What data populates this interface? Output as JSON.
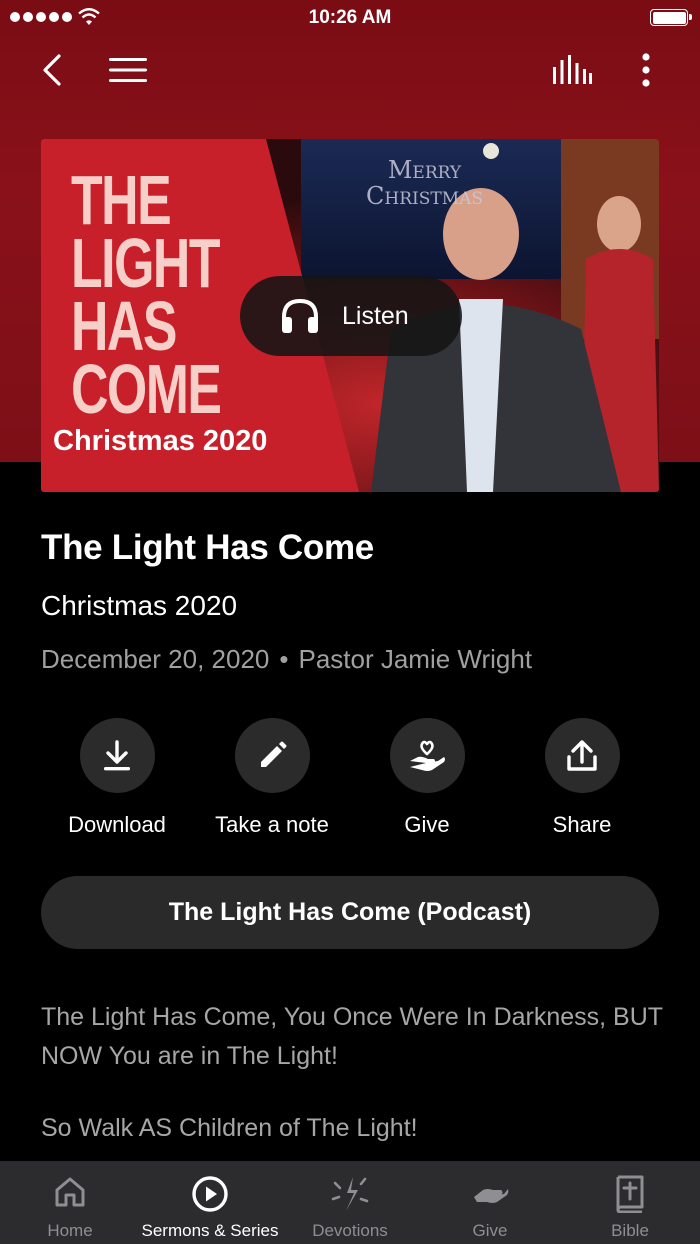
{
  "status_bar": {
    "time": "10:26 AM"
  },
  "nav": {
    "back_icon": "chevron-left-icon",
    "menu_icon": "hamburger-menu-icon",
    "audio_icon": "audio-bars-icon",
    "more_icon": "more-vertical-icon"
  },
  "hero": {
    "artwork_title": "THE\nLIGHT\nHAS\nCOME",
    "artwork_subtitle": "Christmas 2020",
    "backdrop_text": "Merry\nChristmas",
    "listen_label": "Listen",
    "listen_icon": "headphones-icon"
  },
  "sermon": {
    "title": "The Light Has Come",
    "series": "Christmas 2020",
    "date": "December 20, 2020",
    "separator": "•",
    "speaker": "Pastor Jamie Wright"
  },
  "actions": [
    {
      "label": "Download",
      "icon": "download-icon"
    },
    {
      "label": "Take a note",
      "icon": "pencil-icon"
    },
    {
      "label": "Give",
      "icon": "heart-hand-icon"
    },
    {
      "label": "Share",
      "icon": "share-icon"
    }
  ],
  "podcast_button": {
    "label": "The Light Has Come (Podcast)"
  },
  "description": {
    "p1": "The Light Has Come, You Once Were In Darkness, BUT NOW You are in The Light!",
    "p2": "So Walk AS Children of The Light!"
  },
  "tabs": [
    {
      "label": "Home",
      "icon": "home-icon",
      "active": false
    },
    {
      "label": "Sermons & Series",
      "icon": "play-circle-icon",
      "active": true
    },
    {
      "label": "Devotions",
      "icon": "sparkle-icon",
      "active": false
    },
    {
      "label": "Give",
      "icon": "giving-hand-icon",
      "active": false
    },
    {
      "label": "Bible",
      "icon": "bible-icon",
      "active": false
    }
  ],
  "colors": {
    "header_red": "#8a111a",
    "artwork_red": "#c8202a",
    "artwork_text": "#f6cfc8",
    "button_dark": "#2b2b2b",
    "tabbar": "#2c2c2e",
    "inactive_tab": "#8e8e93"
  }
}
